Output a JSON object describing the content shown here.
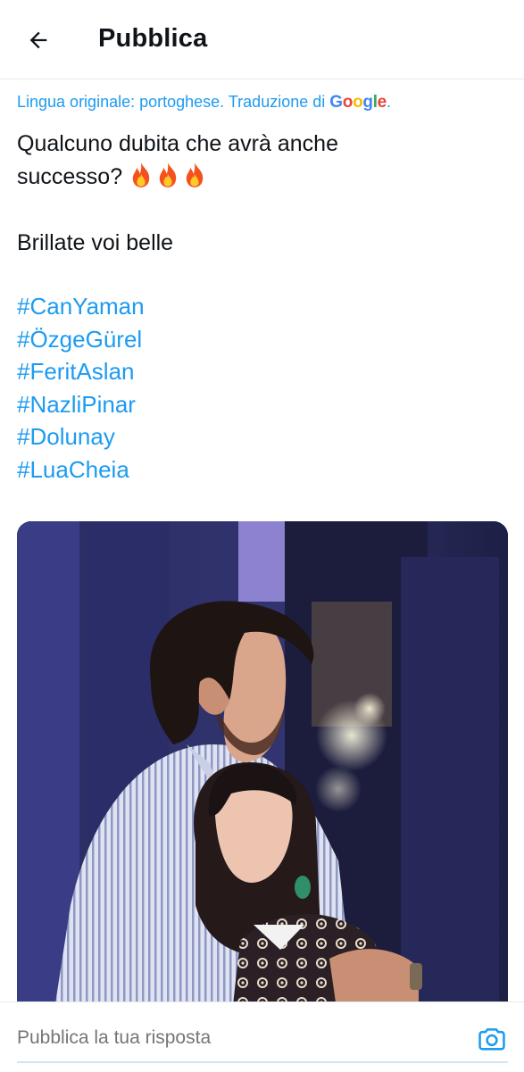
{
  "header": {
    "title": "Pubblica",
    "back_icon": "arrow-left-icon"
  },
  "translation": {
    "label": "Lingua originale: portoghese. Traduzione di",
    "provider_letters": [
      "G",
      "o",
      "o",
      "g",
      "l",
      "e"
    ],
    "period": "."
  },
  "tweet": {
    "line1": "Qualcuno dubita che avrà anche",
    "line2": "successo?",
    "line2_emoji": "fire-icon x3",
    "line3": "Brillate voi belle",
    "hashtags": [
      "#CanYaman",
      "#ÖzgeGürel",
      "#FeritAslan",
      "#NazliPinar",
      "#Dolunay",
      "#LuaCheia"
    ]
  },
  "media": {
    "type": "photo",
    "icon": "photo"
  },
  "reply": {
    "placeholder": "Pubblica la tua risposta",
    "camera_icon": "camera-icon"
  },
  "colors": {
    "link": "#1d9bf0",
    "text": "#0f1419",
    "muted": "#536471"
  }
}
